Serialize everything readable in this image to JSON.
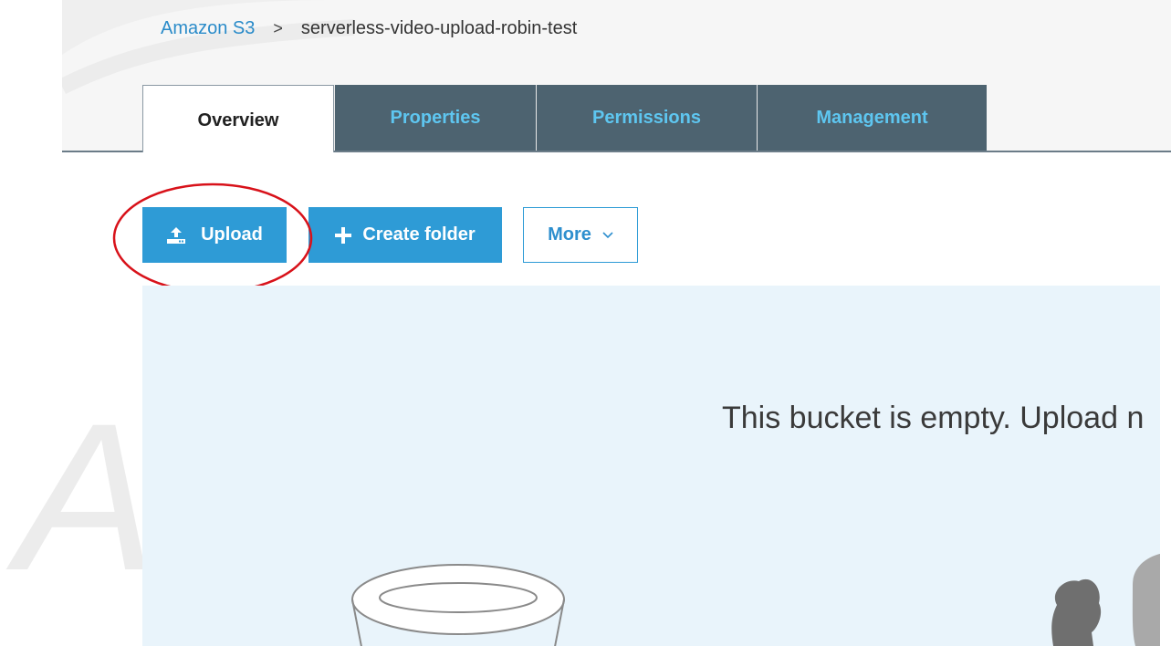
{
  "breadcrumb": {
    "root": "Amazon S3",
    "separator": ">",
    "bucket": "serverless-video-upload-robin-test"
  },
  "tabs": [
    {
      "label": "Overview",
      "active": true
    },
    {
      "label": "Properties",
      "active": false
    },
    {
      "label": "Permissions",
      "active": false
    },
    {
      "label": "Management",
      "active": false
    }
  ],
  "toolbar": {
    "upload_label": "Upload",
    "create_folder_label": "Create folder",
    "more_label": "More"
  },
  "empty_state": {
    "message": "This bucket is empty. Upload n"
  },
  "icons": {
    "upload": "upload-icon",
    "create_folder": "plus-icon",
    "more": "chevron-down-icon"
  },
  "colors": {
    "accent": "#2e9bd6",
    "tab_bar": "#4d6370",
    "tab_text": "#5ec6f0",
    "panel": "#e9f4fb",
    "highlight_ring": "#d8121a"
  }
}
